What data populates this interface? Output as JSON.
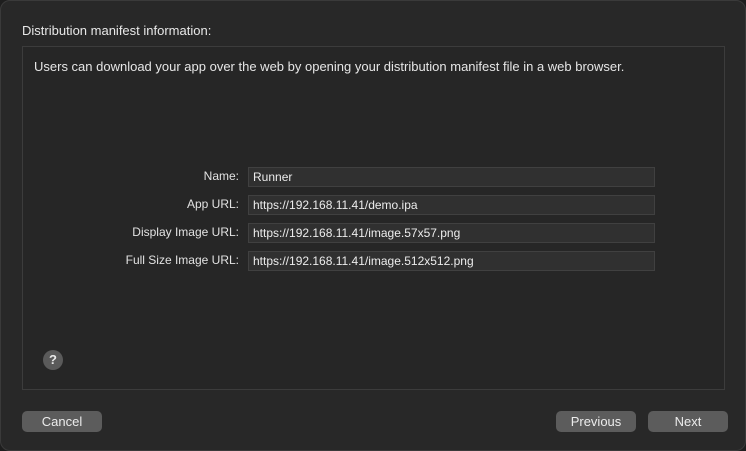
{
  "dialog": {
    "section_title": "Distribution manifest information:",
    "description": "Users can download your app over the web by opening your distribution manifest file in a web browser."
  },
  "form": {
    "fields": [
      {
        "label": "Name:",
        "value": "Runner"
      },
      {
        "label": "App URL:",
        "value": "https://192.168.11.41/demo.ipa"
      },
      {
        "label": "Display Image URL:",
        "value": "https://192.168.11.41/image.57x57.png"
      },
      {
        "label": "Full Size Image URL:",
        "value": "https://192.168.11.41/image.512x512.png"
      }
    ]
  },
  "help": {
    "icon": "question-mark-icon",
    "glyph": "?"
  },
  "buttons": {
    "cancel": "Cancel",
    "previous": "Previous",
    "next": "Next"
  }
}
